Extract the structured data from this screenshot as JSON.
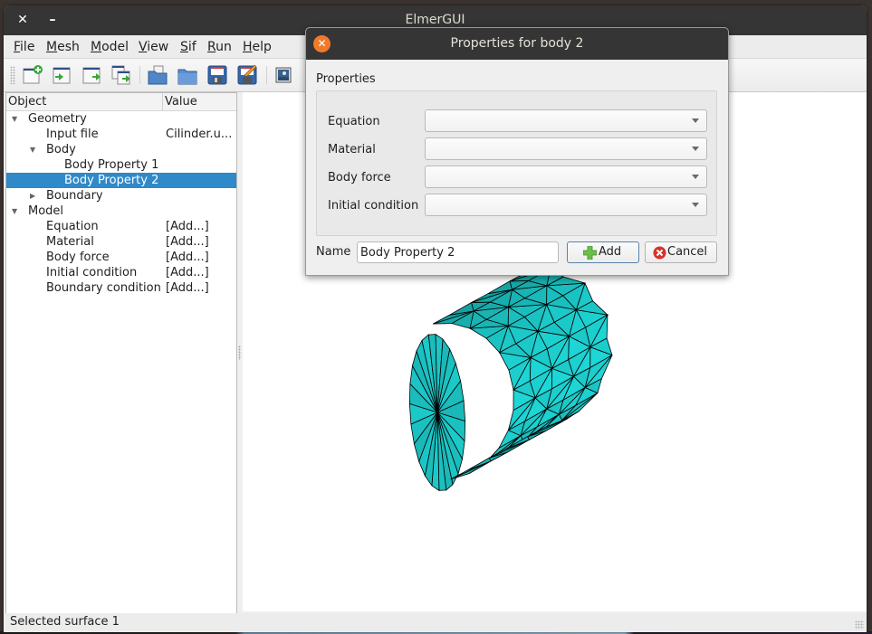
{
  "window": {
    "title": "ElmerGUI",
    "close_glyph": "✕",
    "minimize_glyph": "–"
  },
  "menubar": {
    "items": [
      {
        "label": "File",
        "mnemonic": "F",
        "rest": "ile"
      },
      {
        "label": "Mesh",
        "mnemonic": "M",
        "rest": "esh"
      },
      {
        "label": "Model",
        "mnemonic": "M",
        "rest": "odel"
      },
      {
        "label": "View",
        "mnemonic": "V",
        "rest": "iew"
      },
      {
        "label": "Sif",
        "mnemonic": "S",
        "rest": "if"
      },
      {
        "label": "Run",
        "mnemonic": "R",
        "rest": "un"
      },
      {
        "label": "Help",
        "mnemonic": "H",
        "rest": "elp"
      }
    ]
  },
  "toolbar": {
    "buttons": [
      {
        "icon": "new-project-icon"
      },
      {
        "icon": "load-mesh-icon"
      },
      {
        "icon": "save-mesh-icon"
      },
      {
        "icon": "import-geometry-icon"
      },
      {
        "icon": "open-project-icon"
      },
      {
        "icon": "open-folder-icon"
      },
      {
        "icon": "save-icon"
      },
      {
        "icon": "save-as-icon"
      },
      {
        "icon": "screenshot-icon"
      }
    ]
  },
  "tree": {
    "columns": [
      "Object",
      "Value"
    ],
    "rows": [
      {
        "label": "Geometry",
        "value": "",
        "level": 0,
        "expander": "expanded",
        "selected": false
      },
      {
        "label": "Input file",
        "value": "Cilinder.u...",
        "level": 1,
        "expander": "none",
        "selected": false
      },
      {
        "label": "Body",
        "value": "",
        "level": 1,
        "expander": "expanded",
        "selected": false
      },
      {
        "label": "Body Property 1",
        "value": "",
        "level": 2,
        "expander": "none",
        "selected": false
      },
      {
        "label": "Body Property 2",
        "value": "",
        "level": 2,
        "expander": "none",
        "selected": true
      },
      {
        "label": "Boundary",
        "value": "",
        "level": 1,
        "expander": "collapsed",
        "selected": false
      },
      {
        "label": "Model",
        "value": "",
        "level": 0,
        "expander": "expanded",
        "selected": false
      },
      {
        "label": "Equation",
        "value": "[Add...]",
        "level": 1,
        "expander": "none",
        "selected": false
      },
      {
        "label": "Material",
        "value": "[Add...]",
        "level": 1,
        "expander": "none",
        "selected": false
      },
      {
        "label": "Body force",
        "value": "[Add...]",
        "level": 1,
        "expander": "none",
        "selected": false
      },
      {
        "label": "Initial condition",
        "value": "[Add...]",
        "level": 1,
        "expander": "none",
        "selected": false
      },
      {
        "label": "Boundary condition",
        "value": "[Add...]",
        "level": 1,
        "expander": "none",
        "selected": false
      }
    ]
  },
  "viewport": {
    "object": "cylinder-mesh",
    "mesh_color": "#1ed6d6",
    "edge_color": "#000000"
  },
  "statusbar": {
    "text": "Selected surface 1"
  },
  "dialog": {
    "title": "Properties for body 2",
    "group_title": "Properties",
    "fields": [
      {
        "label": "Equation",
        "value": ""
      },
      {
        "label": "Material",
        "value": ""
      },
      {
        "label": "Body force",
        "value": ""
      },
      {
        "label": "Initial condition",
        "value": ""
      }
    ],
    "name_label": "Name",
    "name_value": "Body Property 2",
    "add_label": "Add",
    "cancel_label": "Cancel",
    "close_glyph": "✕"
  },
  "colors": {
    "titlebar": "#353535",
    "selection": "#3089c9",
    "dialog_close": "#f07a2a"
  }
}
